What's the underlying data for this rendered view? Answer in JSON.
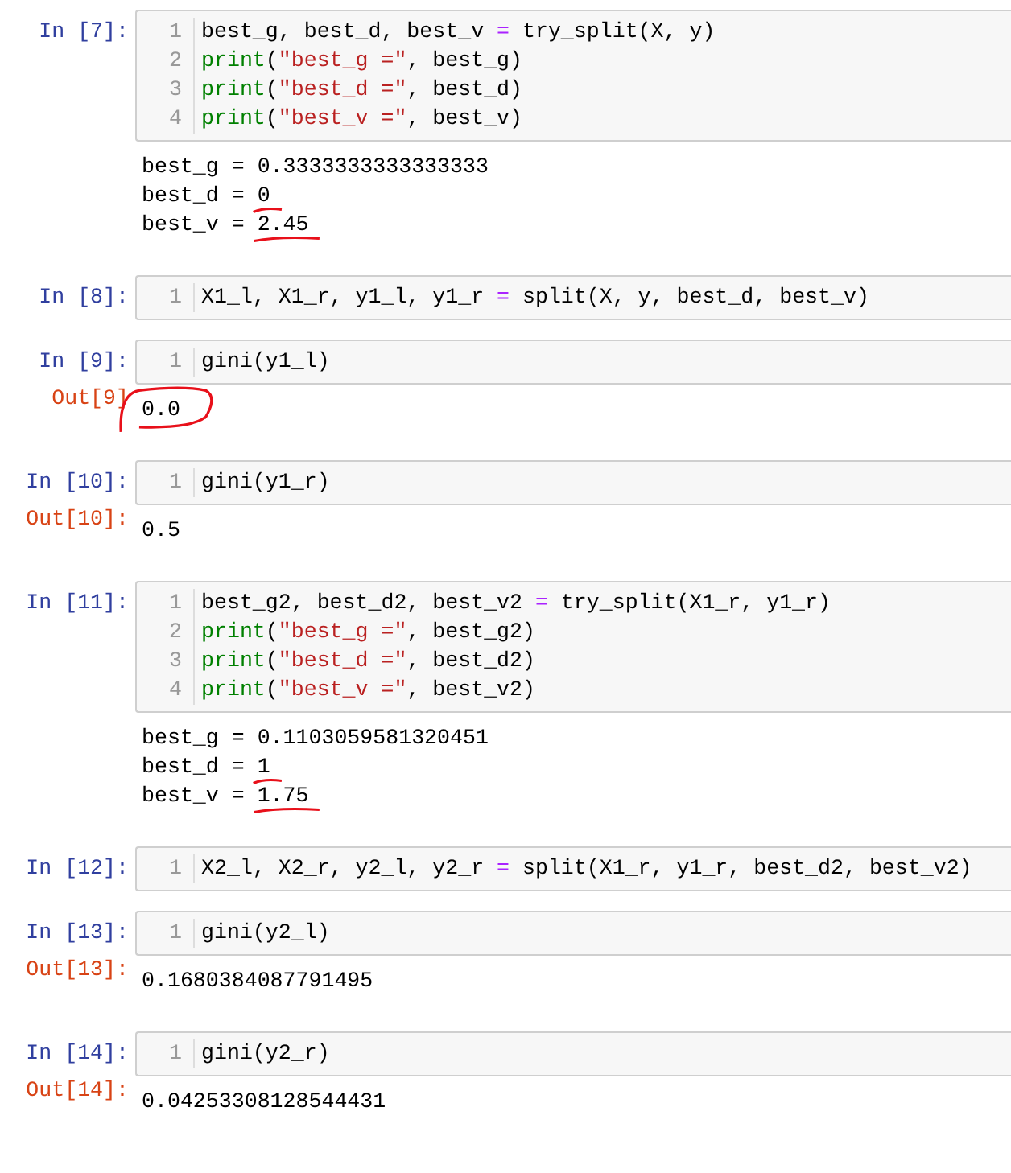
{
  "cells": [
    {
      "prompt": "In [7]:",
      "lines": [
        {
          "number": "1",
          "tokens": [
            {
              "kind": "plain",
              "text": "best_g, best_d, best_v "
            },
            {
              "kind": "operator",
              "text": "="
            },
            {
              "kind": "plain",
              "text": " try_split(X, y)"
            }
          ]
        },
        {
          "number": "2",
          "tokens": [
            {
              "kind": "builtin",
              "text": "print"
            },
            {
              "kind": "plain",
              "text": "("
            },
            {
              "kind": "string",
              "text": "\"best_g =\""
            },
            {
              "kind": "plain",
              "text": ", best_g)"
            }
          ]
        },
        {
          "number": "3",
          "tokens": [
            {
              "kind": "builtin",
              "text": "print"
            },
            {
              "kind": "plain",
              "text": "("
            },
            {
              "kind": "string",
              "text": "\"best_d =\""
            },
            {
              "kind": "plain",
              "text": ", best_d)"
            }
          ]
        },
        {
          "number": "4",
          "tokens": [
            {
              "kind": "builtin",
              "text": "print"
            },
            {
              "kind": "plain",
              "text": "("
            },
            {
              "kind": "string",
              "text": "\"best_v =\""
            },
            {
              "kind": "plain",
              "text": ", best_v)"
            }
          ]
        }
      ],
      "output": {
        "lines": [
          {
            "text": "best_g = 0.3333333333333333",
            "kind": "plain"
          },
          {
            "text": "best_d = 0",
            "kind": "underlined"
          },
          {
            "text": "best_v = 2.45",
            "kind": "underlined"
          }
        ]
      }
    },
    {
      "prompt": "In [8]:",
      "lines": [
        {
          "number": "1",
          "tokens": [
            {
              "kind": "plain",
              "text": "X1_l, X1_r, y1_l, y1_r "
            },
            {
              "kind": "operator",
              "text": "="
            },
            {
              "kind": "plain",
              "text": " split(X, y, best_d, best_v)"
            }
          ]
        }
      ]
    },
    {
      "prompt": "In [9]:",
      "lines": [
        {
          "number": "1",
          "tokens": [
            {
              "kind": "plain",
              "text": "gini(y1_l)"
            }
          ]
        }
      ],
      "output": {
        "prompt": "Out[9]",
        "lines": [
          {
            "text": "0.0",
            "kind": "circled"
          }
        ]
      }
    },
    {
      "prompt": "In [10]:",
      "lines": [
        {
          "number": "1",
          "tokens": [
            {
              "kind": "plain",
              "text": "gini(y1_r)"
            }
          ]
        }
      ],
      "output": {
        "prompt": "Out[10]:",
        "lines": [
          {
            "text": "0.5",
            "kind": "plain"
          }
        ]
      }
    },
    {
      "prompt": "In [11]:",
      "lines": [
        {
          "number": "1",
          "tokens": [
            {
              "kind": "plain",
              "text": "best_g2, best_d2, best_v2 "
            },
            {
              "kind": "operator",
              "text": "="
            },
            {
              "kind": "plain",
              "text": " try_split(X1_r, y1_r)"
            }
          ]
        },
        {
          "number": "2",
          "tokens": [
            {
              "kind": "builtin",
              "text": "print"
            },
            {
              "kind": "plain",
              "text": "("
            },
            {
              "kind": "string",
              "text": "\"best_g =\""
            },
            {
              "kind": "plain",
              "text": ", best_g2)"
            }
          ]
        },
        {
          "number": "3",
          "tokens": [
            {
              "kind": "builtin",
              "text": "print"
            },
            {
              "kind": "plain",
              "text": "("
            },
            {
              "kind": "string",
              "text": "\"best_d =\""
            },
            {
              "kind": "plain",
              "text": ", best_d2)"
            }
          ]
        },
        {
          "number": "4",
          "tokens": [
            {
              "kind": "builtin",
              "text": "print"
            },
            {
              "kind": "plain",
              "text": "("
            },
            {
              "kind": "string",
              "text": "\"best_v =\""
            },
            {
              "kind": "plain",
              "text": ", best_v2)"
            }
          ]
        }
      ],
      "output": {
        "lines": [
          {
            "text": "best_g = 0.1103059581320451",
            "kind": "plain"
          },
          {
            "text": "best_d = 1",
            "kind": "underlined"
          },
          {
            "text": "best_v = 1.75",
            "kind": "underlined"
          }
        ]
      }
    },
    {
      "prompt": "In [12]:",
      "lines": [
        {
          "number": "1",
          "tokens": [
            {
              "kind": "plain",
              "text": "X2_l, X2_r, y2_l, y2_r "
            },
            {
              "kind": "operator",
              "text": "="
            },
            {
              "kind": "plain",
              "text": " split(X1_r, y1_r, best_d2, best_v2)"
            }
          ]
        }
      ]
    },
    {
      "prompt": "In [13]:",
      "lines": [
        {
          "number": "1",
          "tokens": [
            {
              "kind": "plain",
              "text": "gini(y2_l)"
            }
          ]
        }
      ],
      "output": {
        "prompt": "Out[13]:",
        "lines": [
          {
            "text": "0.1680384087791495",
            "kind": "plain"
          }
        ]
      }
    },
    {
      "prompt": "In [14]:",
      "lines": [
        {
          "number": "1",
          "tokens": [
            {
              "kind": "plain",
              "text": "gini(y2_r)"
            }
          ]
        }
      ],
      "output": {
        "prompt": "Out[14]:",
        "lines": [
          {
            "text": "0.04253308128544431",
            "kind": "plain"
          }
        ]
      }
    }
  ]
}
